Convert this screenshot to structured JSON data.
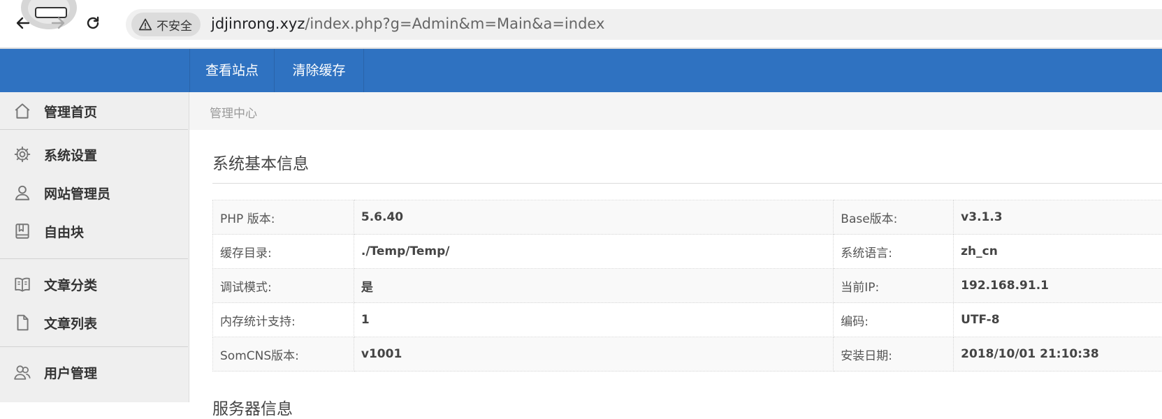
{
  "browser": {
    "security_label": "不安全",
    "url_host": "jdjinrong.xyz",
    "url_path": "/index.php?g=Admin&m=Main&a=index"
  },
  "topbar": {
    "items": [
      "查看站点",
      "清除缓存"
    ]
  },
  "sidebar": {
    "items": [
      {
        "label": "管理首页",
        "icon": "home-icon"
      },
      {
        "label": "系统设置",
        "icon": "gear-icon"
      },
      {
        "label": "网站管理员",
        "icon": "user-icon"
      },
      {
        "label": "自由块",
        "icon": "book-icon"
      },
      {
        "label": "文章分类",
        "icon": "open-book-icon"
      },
      {
        "label": "文章列表",
        "icon": "file-icon"
      },
      {
        "label": "用户管理",
        "icon": "users-icon"
      }
    ]
  },
  "main": {
    "breadcrumb": "管理中心",
    "section_title": "系统基本信息",
    "next_section_title": "服务器信息",
    "rows": [
      {
        "k1": "PHP 版本:",
        "v1": "5.6.40",
        "k2": "Base版本:",
        "v2": "v3.1.3"
      },
      {
        "k1": "缓存目录:",
        "v1": "./Temp/Temp/",
        "k2": "系统语言:",
        "v2": "zh_cn"
      },
      {
        "k1": "调试模式:",
        "v1": "是",
        "k2": "当前IP:",
        "v2": "192.168.91.1"
      },
      {
        "k1": "内存统计支持:",
        "v1": "1",
        "k2": "编码:",
        "v2": "UTF-8"
      },
      {
        "k1": "SomCNS版本:",
        "v1": "v1001",
        "k2": "安装日期:",
        "v2": "2018/10/01 21:10:38"
      }
    ]
  },
  "colors": {
    "topbar_blue": "#2f72c1",
    "sidebar_bg": "#efefef"
  }
}
